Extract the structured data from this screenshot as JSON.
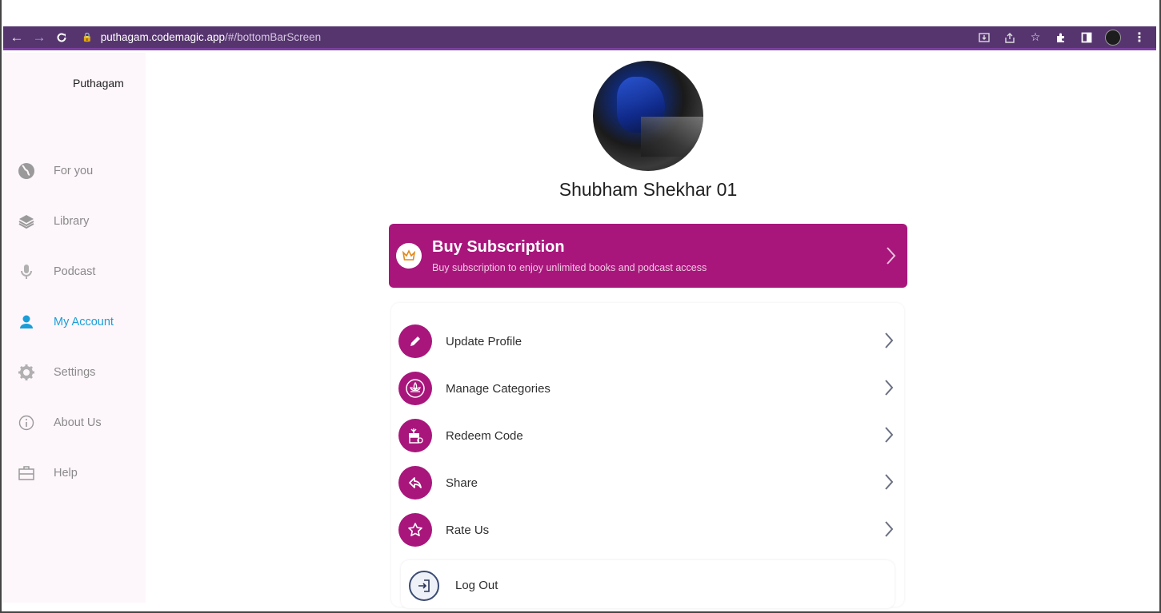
{
  "browser": {
    "url_host": "puthagam.codemagic.app",
    "url_path": "/#/bottomBarScreen"
  },
  "sidebar": {
    "app_title": "Puthagam",
    "items": [
      {
        "label": "For you",
        "icon": "globe-icon",
        "active": false
      },
      {
        "label": "Library",
        "icon": "layers-icon",
        "active": false
      },
      {
        "label": "Podcast",
        "icon": "microphone-icon",
        "active": false
      },
      {
        "label": "My Account",
        "icon": "person-icon",
        "active": true
      },
      {
        "label": "Settings",
        "icon": "gear-icon",
        "active": false
      },
      {
        "label": "About Us",
        "icon": "info-icon",
        "active": false
      },
      {
        "label": "Help",
        "icon": "briefcase-icon",
        "active": false
      }
    ],
    "active_color": "#1a9ed8"
  },
  "profile": {
    "name": "Shubham Shekhar 01"
  },
  "subscription": {
    "title": "Buy Subscription",
    "description": "Buy subscription to enjoy unlimited books and podcast access",
    "color": "#a8167c"
  },
  "menu": {
    "items": [
      {
        "label": "Update Profile",
        "icon": "pencil-icon"
      },
      {
        "label": "Manage Categories",
        "icon": "categories-icon"
      },
      {
        "label": "Redeem Code",
        "icon": "gift-icon"
      },
      {
        "label": "Share",
        "icon": "share-icon"
      },
      {
        "label": "Rate Us",
        "icon": "star-icon"
      }
    ],
    "logout_label": "Log Out"
  }
}
